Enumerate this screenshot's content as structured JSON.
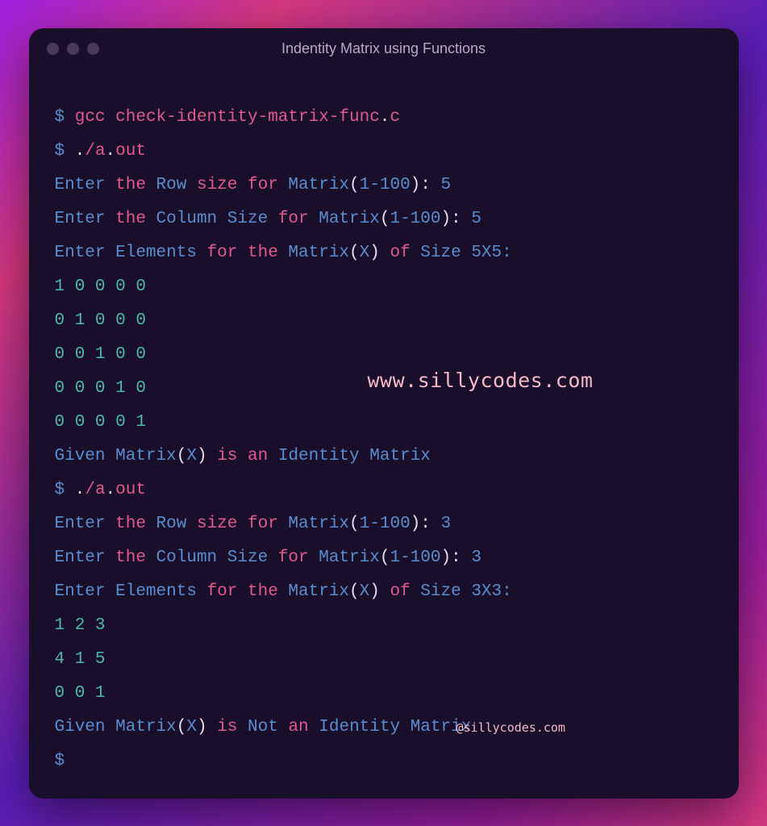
{
  "window": {
    "title": "Indentity Matrix using Functions"
  },
  "watermarks": {
    "main": "www.sillycodes.com",
    "handle": "@sillycodes.com"
  },
  "cmd1": {
    "dollar": "$",
    "gcc": "gcc",
    "file_stem": "check-identity-matrix-func",
    "dot": ".",
    "ext": "c"
  },
  "cmd2": {
    "dollar": "$",
    "dotslash": ".",
    "slash": "/",
    "a": "a",
    "dot": ".",
    "out": "out"
  },
  "run1": {
    "l1_a": "Enter",
    "l1_b": "the",
    "l1_c": "Row",
    "l1_d": "size",
    "l1_e": "for",
    "l1_f": "Matrix",
    "l1_g": "(",
    "l1_h": "1-100",
    "l1_i": "):",
    "l1_j": "5",
    "l2_a": "Enter",
    "l2_b": "the",
    "l2_c": "Column",
    "l2_d": "Size",
    "l2_e": "for",
    "l2_f": "Matrix",
    "l2_g": "(",
    "l2_h": "1-100",
    "l2_i": "):",
    "l2_j": "5",
    "l3_a": "Enter",
    "l3_b": "Elements",
    "l3_c": "for",
    "l3_d": "the",
    "l3_e": "Matrix",
    "l3_f": "(",
    "l3_g": "X",
    "l3_h": ")",
    "l3_i": "of",
    "l3_j": "Size",
    "l3_k": "5X5:",
    "m1": "1 0 0 0 0",
    "m2": "0 1 0 0 0",
    "m3": "0 0 1 0 0",
    "m4": "0 0 0 1 0",
    "m5": "0 0 0 0 1",
    "r_a": "Given",
    "r_b": "Matrix",
    "r_c": "(",
    "r_d": "X",
    "r_e": ")",
    "r_f": "is",
    "r_g": "an",
    "r_h": "Identity",
    "r_i": "Matrix"
  },
  "run2": {
    "l1_a": "Enter",
    "l1_b": "the",
    "l1_c": "Row",
    "l1_d": "size",
    "l1_e": "for",
    "l1_f": "Matrix",
    "l1_g": "(",
    "l1_h": "1-100",
    "l1_i": "):",
    "l1_j": "3",
    "l2_a": "Enter",
    "l2_b": "the",
    "l2_c": "Column",
    "l2_d": "Size",
    "l2_e": "for",
    "l2_f": "Matrix",
    "l2_g": "(",
    "l2_h": "1-100",
    "l2_i": "):",
    "l2_j": "3",
    "l3_a": "Enter",
    "l3_b": "Elements",
    "l3_c": "for",
    "l3_d": "the",
    "l3_e": "Matrix",
    "l3_f": "(",
    "l3_g": "X",
    "l3_h": ")",
    "l3_i": "of",
    "l3_j": "Size",
    "l3_k": "3X3:",
    "m1": "1 2 3",
    "m2": "4 1 5",
    "m3": "0 0 1",
    "r_a": "Given",
    "r_b": "Matrix",
    "r_c": "(",
    "r_d": "X",
    "r_e": ")",
    "r_f": "is",
    "r_g": "Not",
    "r_h": "an",
    "r_i": "Identity",
    "r_j": "Matrix"
  },
  "prompt_end": "$"
}
